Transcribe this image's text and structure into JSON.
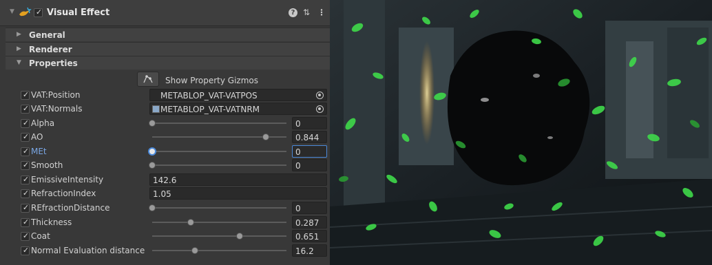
{
  "component": {
    "title": "Visual Effect",
    "enabled": true,
    "icons": [
      "visual-effect-icon",
      "help-icon",
      "preset-icon",
      "menu-icon"
    ]
  },
  "sections": [
    {
      "label": "General",
      "expanded": false
    },
    {
      "label": "Renderer",
      "expanded": false
    },
    {
      "label": "Properties",
      "expanded": true
    }
  ],
  "gizmo": {
    "label": "Show Property Gizmos"
  },
  "properties": [
    {
      "label": "VAT:Position",
      "type": "texture",
      "value": "METABLOP_VAT-VATPOS"
    },
    {
      "label": "VAT:Normals",
      "type": "texture",
      "value": "METABLOP_VAT-VATNRM"
    },
    {
      "label": "Alpha",
      "type": "slider",
      "value": "0",
      "fraction": 0.0
    },
    {
      "label": "AO",
      "type": "slider",
      "value": "0.844",
      "fraction": 0.844
    },
    {
      "label": "MEt",
      "type": "slider",
      "value": "0",
      "fraction": 0.0,
      "focused": true
    },
    {
      "label": "Smooth",
      "type": "slider",
      "value": "0",
      "fraction": 0.0
    },
    {
      "label": "EmissiveIntensity",
      "type": "field",
      "value": "142.6"
    },
    {
      "label": "RefractionIndex",
      "type": "field",
      "value": "1.05"
    },
    {
      "label": "REfractionDistance",
      "type": "slider",
      "value": "0",
      "fraction": 0.0
    },
    {
      "label": "Thickness",
      "type": "slider",
      "value": "0.287",
      "fraction": 0.287
    },
    {
      "label": "Coat",
      "type": "slider",
      "value": "0.651",
      "fraction": 0.651
    },
    {
      "label": "Normal Evaluation distance",
      "type": "slider",
      "value": "16.2",
      "fraction": 0.32
    }
  ],
  "colors": {
    "panel": "#383838",
    "accent": "#4a88d8",
    "glow": "#3fd94a",
    "blob": "#08090a"
  }
}
